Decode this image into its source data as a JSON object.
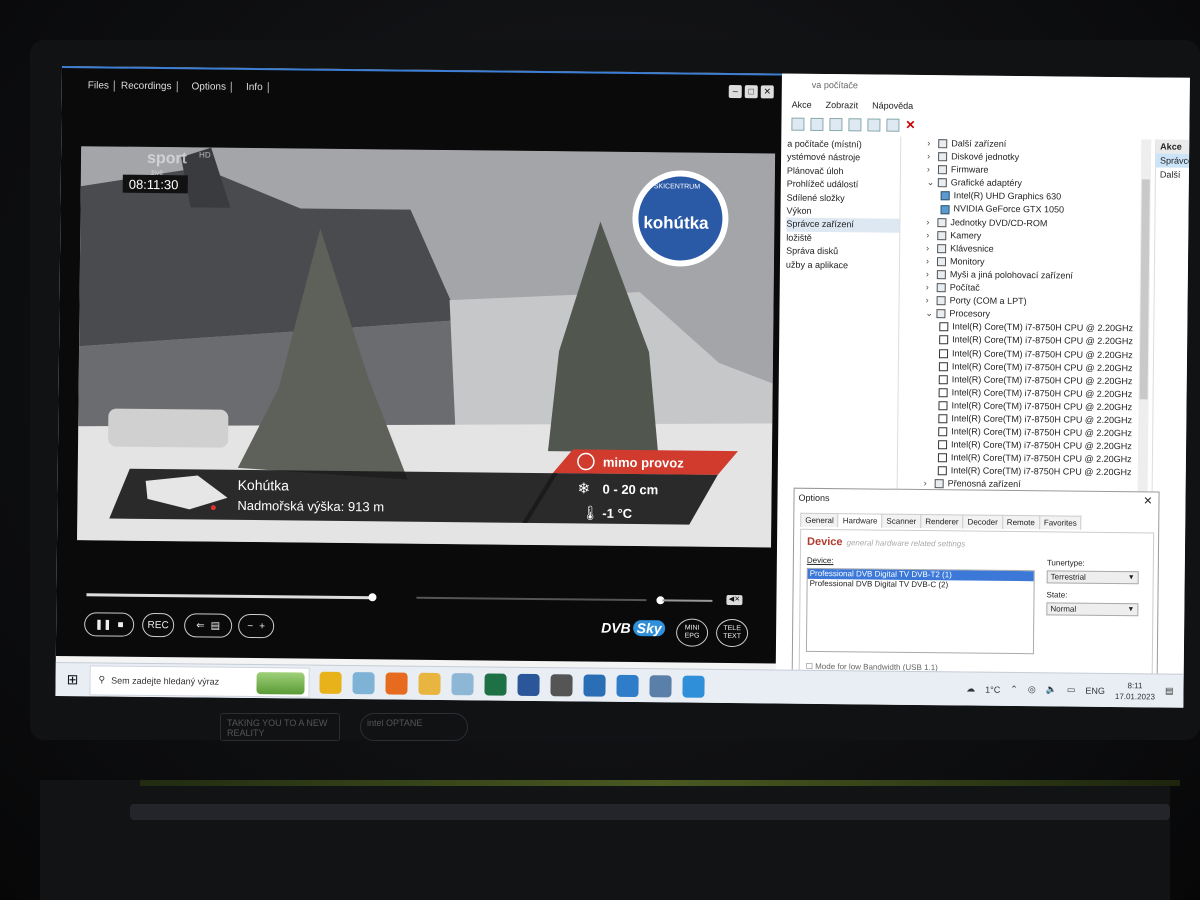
{
  "player": {
    "menu": [
      "Files",
      "Recordings",
      "Options",
      "Info"
    ],
    "window_buttons": [
      "–",
      "□",
      "✕"
    ],
    "channel_logo": "sport",
    "channel_sub": "HD",
    "channel_live": "živě",
    "time": "08:11:30",
    "resort_logo": "kohútka",
    "resort_logo_ring": "SKICENTRUM",
    "location": "Kohútka",
    "altitude": "Nadmořská výška: 913 m",
    "status": "mimo provoz",
    "snow": "0 - 20 cm",
    "temperature": "-1 °C",
    "controls": {
      "rec": "REC",
      "mini_epg": [
        "MINI",
        "EPG"
      ],
      "teletext": [
        "TELE",
        "TEXT"
      ],
      "brand": "DVB",
      "brand_sub": "Sky"
    },
    "seek_progress": 0.51,
    "volume_level": 0.05
  },
  "devmgr": {
    "title": "va počítače",
    "menu": [
      "Akce",
      "Zobrazit",
      "Nápověda"
    ],
    "left": [
      "a počítače (místní)",
      "ystémové nástroje",
      "Plánovač úloh",
      "Prohlížeč událostí",
      "Sdílené složky",
      "Výkon",
      "Správce zařízení",
      "ložiště",
      "Správa disků",
      "užby a aplikace"
    ],
    "tree": [
      {
        "level": 1,
        "label": "Další zařízení"
      },
      {
        "level": 1,
        "label": "Diskové jednotky"
      },
      {
        "level": 1,
        "label": "Firmware"
      },
      {
        "level": 1,
        "label": "Grafické adaptéry",
        "open": true
      },
      {
        "level": 2,
        "label": "Intel(R) UHD Graphics 630",
        "gpu": true
      },
      {
        "level": 2,
        "label": "NVIDIA GeForce GTX 1050",
        "gpu": true
      },
      {
        "level": 1,
        "label": "Jednotky DVD/CD-ROM"
      },
      {
        "level": 1,
        "label": "Kamery"
      },
      {
        "level": 1,
        "label": "Klávesnice"
      },
      {
        "level": 1,
        "label": "Monitory"
      },
      {
        "level": 1,
        "label": "Myši a jiná polohovací zařízení"
      },
      {
        "level": 1,
        "label": "Počítač"
      },
      {
        "level": 1,
        "label": "Porty (COM a LPT)"
      },
      {
        "level": 1,
        "label": "Procesory",
        "open": true
      },
      {
        "level": 2,
        "label": "Intel(R) Core(TM) i7-8750H CPU @ 2.20GHz"
      },
      {
        "level": 2,
        "label": "Intel(R) Core(TM) i7-8750H CPU @ 2.20GHz"
      },
      {
        "level": 2,
        "label": "Intel(R) Core(TM) i7-8750H CPU @ 2.20GHz"
      },
      {
        "level": 2,
        "label": "Intel(R) Core(TM) i7-8750H CPU @ 2.20GHz"
      },
      {
        "level": 2,
        "label": "Intel(R) Core(TM) i7-8750H CPU @ 2.20GHz"
      },
      {
        "level": 2,
        "label": "Intel(R) Core(TM) i7-8750H CPU @ 2.20GHz"
      },
      {
        "level": 2,
        "label": "Intel(R) Core(TM) i7-8750H CPU @ 2.20GHz"
      },
      {
        "level": 2,
        "label": "Intel(R) Core(TM) i7-8750H CPU @ 2.20GHz"
      },
      {
        "level": 2,
        "label": "Intel(R) Core(TM) i7-8750H CPU @ 2.20GHz"
      },
      {
        "level": 2,
        "label": "Intel(R) Core(TM) i7-8750H CPU @ 2.20GHz"
      },
      {
        "level": 2,
        "label": "Intel(R) Core(TM) i7-8750H CPU @ 2.20GHz"
      },
      {
        "level": 2,
        "label": "Intel(R) Core(TM) i7-8750H CPU @ 2.20GHz"
      },
      {
        "level": 1,
        "label": "Přenosná zařízení"
      }
    ],
    "actions_header": "Akce",
    "actions": [
      "Správce z",
      "Další"
    ]
  },
  "options": {
    "title": "Options",
    "tabs": [
      "General",
      "Hardware",
      "Scanner",
      "Renderer",
      "Decoder",
      "Remote",
      "Favorites"
    ],
    "active_tab": "Hardware",
    "section": "Device",
    "section_sub": "general hardware related settings",
    "device_label": "Device:",
    "devices": [
      "Professional DVB Digital TV DVB-T2 (1)",
      "Professional DVB Digital TV DVB-C (2)"
    ],
    "selected_device": 0,
    "tunertype_label": "Tunertype:",
    "tunertype": "Terrestrial",
    "state_label": "State:",
    "state": "Normal",
    "low_bw": "Mode for low Bandwidth (USB 1.1)"
  },
  "taskbar": {
    "search_placeholder": "Sem zadejte hledaný výraz",
    "weather": "1°C",
    "lang": "ENG",
    "time": "8:11",
    "date": "17.01.2023",
    "apps": [
      "chrome",
      "paint",
      "firefox",
      "explorer",
      "notepad",
      "excel",
      "word",
      "calculator",
      "mail",
      "vscode",
      "install",
      "dvbsky"
    ]
  },
  "laptop": {
    "sticker1": "TAKING YOU TO A NEW REALITY",
    "sticker2": "intel OPTANE"
  }
}
